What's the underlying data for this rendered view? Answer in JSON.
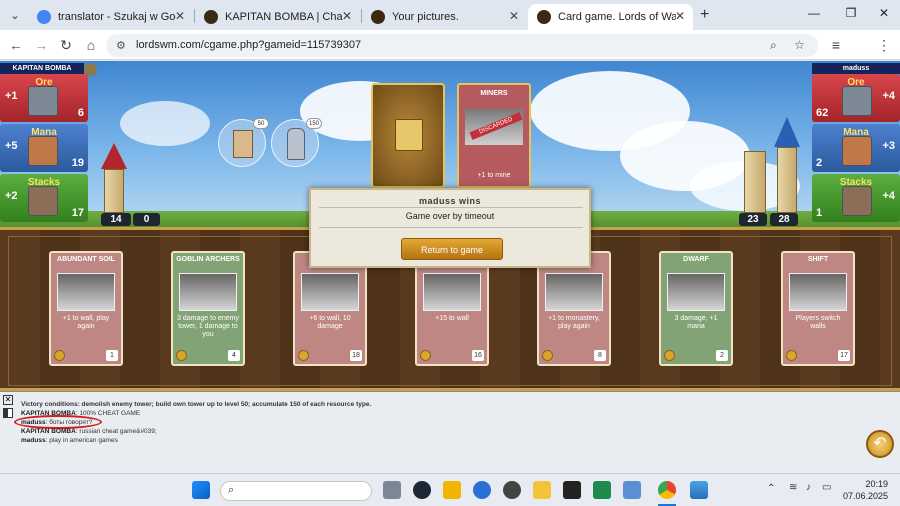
{
  "browser": {
    "tabs": [
      {
        "title": "translator - Szukaj w Google",
        "active": false,
        "favicon_color": "#4285f4"
      },
      {
        "title": "KAPITAN BOMBA | Character in",
        "active": false,
        "favicon_color": "#3a2a14"
      },
      {
        "title": "Your pictures.",
        "active": false,
        "favicon_color": "#3a2a14"
      },
      {
        "title": "Card game. Lords of War and M",
        "active": true,
        "favicon_color": "#3a2a14"
      }
    ],
    "url": "lordswm.com/cgame.php?gameid=115739307"
  },
  "game": {
    "left_player": {
      "name": "KAPITAN BOMBA",
      "resources": [
        {
          "name": "Ore",
          "income": "+1",
          "value": "6"
        },
        {
          "name": "Mana",
          "income": "+5",
          "value": "19"
        },
        {
          "name": "Stacks",
          "income": "+2",
          "value": "17"
        }
      ],
      "tower": "14",
      "wall": "0"
    },
    "right_player": {
      "name": "maduss",
      "resources": [
        {
          "name": "Ore",
          "income": "+4",
          "value": "62"
        },
        {
          "name": "Mana",
          "income": "+3",
          "value": "2"
        },
        {
          "name": "Stacks",
          "income": "+4",
          "value": "1"
        }
      ],
      "tower": "23",
      "wall": "28"
    },
    "bubbles": {
      "castle_value": "50",
      "knight_value": "150"
    },
    "played_card": {
      "title": "MINERS",
      "stamp": "DISCARDED",
      "desc": "+1 to mine"
    },
    "modal": {
      "title": "maduss wins",
      "message": "Game over by timeout",
      "button": "Return to game"
    },
    "hand": [
      {
        "title": "ABUNDANT SOIL",
        "desc": "+1 to wall, play again",
        "cost": "1",
        "color": "red"
      },
      {
        "title": "GOBLIN ARCHERS",
        "desc": "3 damage to enemy tower, 1 damage to you",
        "cost": "4",
        "color": "green"
      },
      {
        "title": "",
        "desc": "+6 to wall, 10 damage",
        "cost": "18",
        "color": "red"
      },
      {
        "title": "WALL",
        "desc": "+15 to wall",
        "cost": "16",
        "color": "red"
      },
      {
        "title": "CAPTAIN",
        "desc": "+1 to monastery, play again",
        "cost": "8",
        "color": "red"
      },
      {
        "title": "DWARF",
        "desc": "3 damage, +1 mana",
        "cost": "2",
        "color": "green"
      },
      {
        "title": "SHIFT",
        "desc": "Players switch walls",
        "cost": "17",
        "color": "red"
      }
    ],
    "chat": {
      "victory": "Victory conditions: demolish enemy tower; build own tower up to level 50; accumulate 150 of each resource type.",
      "lines": [
        {
          "user": "KAPITAN BOMBA",
          "text": ": 100% CHEAT GAME"
        },
        {
          "user": "maduss",
          "text": ": боты говорят?"
        },
        {
          "user": "KAPITAN BOMBA",
          "text": ": russian cheat game&#039;"
        },
        {
          "user": "maduss",
          "text": ": play in american games"
        }
      ]
    }
  },
  "taskbar": {
    "time": "20:19",
    "date": "07.06.2025"
  }
}
